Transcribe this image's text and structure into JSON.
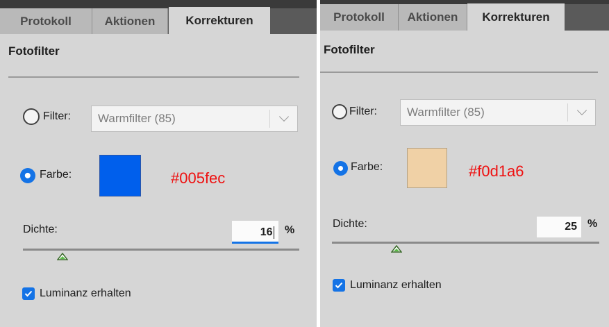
{
  "panels": [
    {
      "tabs": [
        "Protokoll",
        "Aktionen",
        "Korrekturen"
      ],
      "active_tab": "Korrekturen",
      "title": "Fotofilter",
      "filter_label": "Filter:",
      "filter_value": "Warmfilter (85)",
      "color_label": "Farbe:",
      "swatch_color": "#005fec",
      "hex_annotation": "#005fec",
      "density_label": "Dichte:",
      "density_value": "16",
      "density_unit": "%",
      "density_fraction": 0.16,
      "density_focused": true,
      "luminance_label": "Luminanz erhalten",
      "luminance_checked": true,
      "filter_selected": false,
      "color_selected": true
    },
    {
      "tabs": [
        "Protokoll",
        "Aktionen",
        "Korrekturen"
      ],
      "active_tab": "Korrekturen",
      "title": "Fotofilter",
      "filter_label": "Filter:",
      "filter_value": "Warmfilter (85)",
      "color_label": "Farbe:",
      "swatch_color": "#f0d1a6",
      "hex_annotation": "#f0d1a6",
      "density_label": "Dichte:",
      "density_value": "25",
      "density_unit": "%",
      "density_fraction": 0.25,
      "density_focused": false,
      "luminance_label": "Luminanz erhalten",
      "luminance_checked": true,
      "filter_selected": false,
      "color_selected": true
    }
  ],
  "colors": {
    "accent": "#1473e6",
    "annotation": "#ee1111"
  }
}
